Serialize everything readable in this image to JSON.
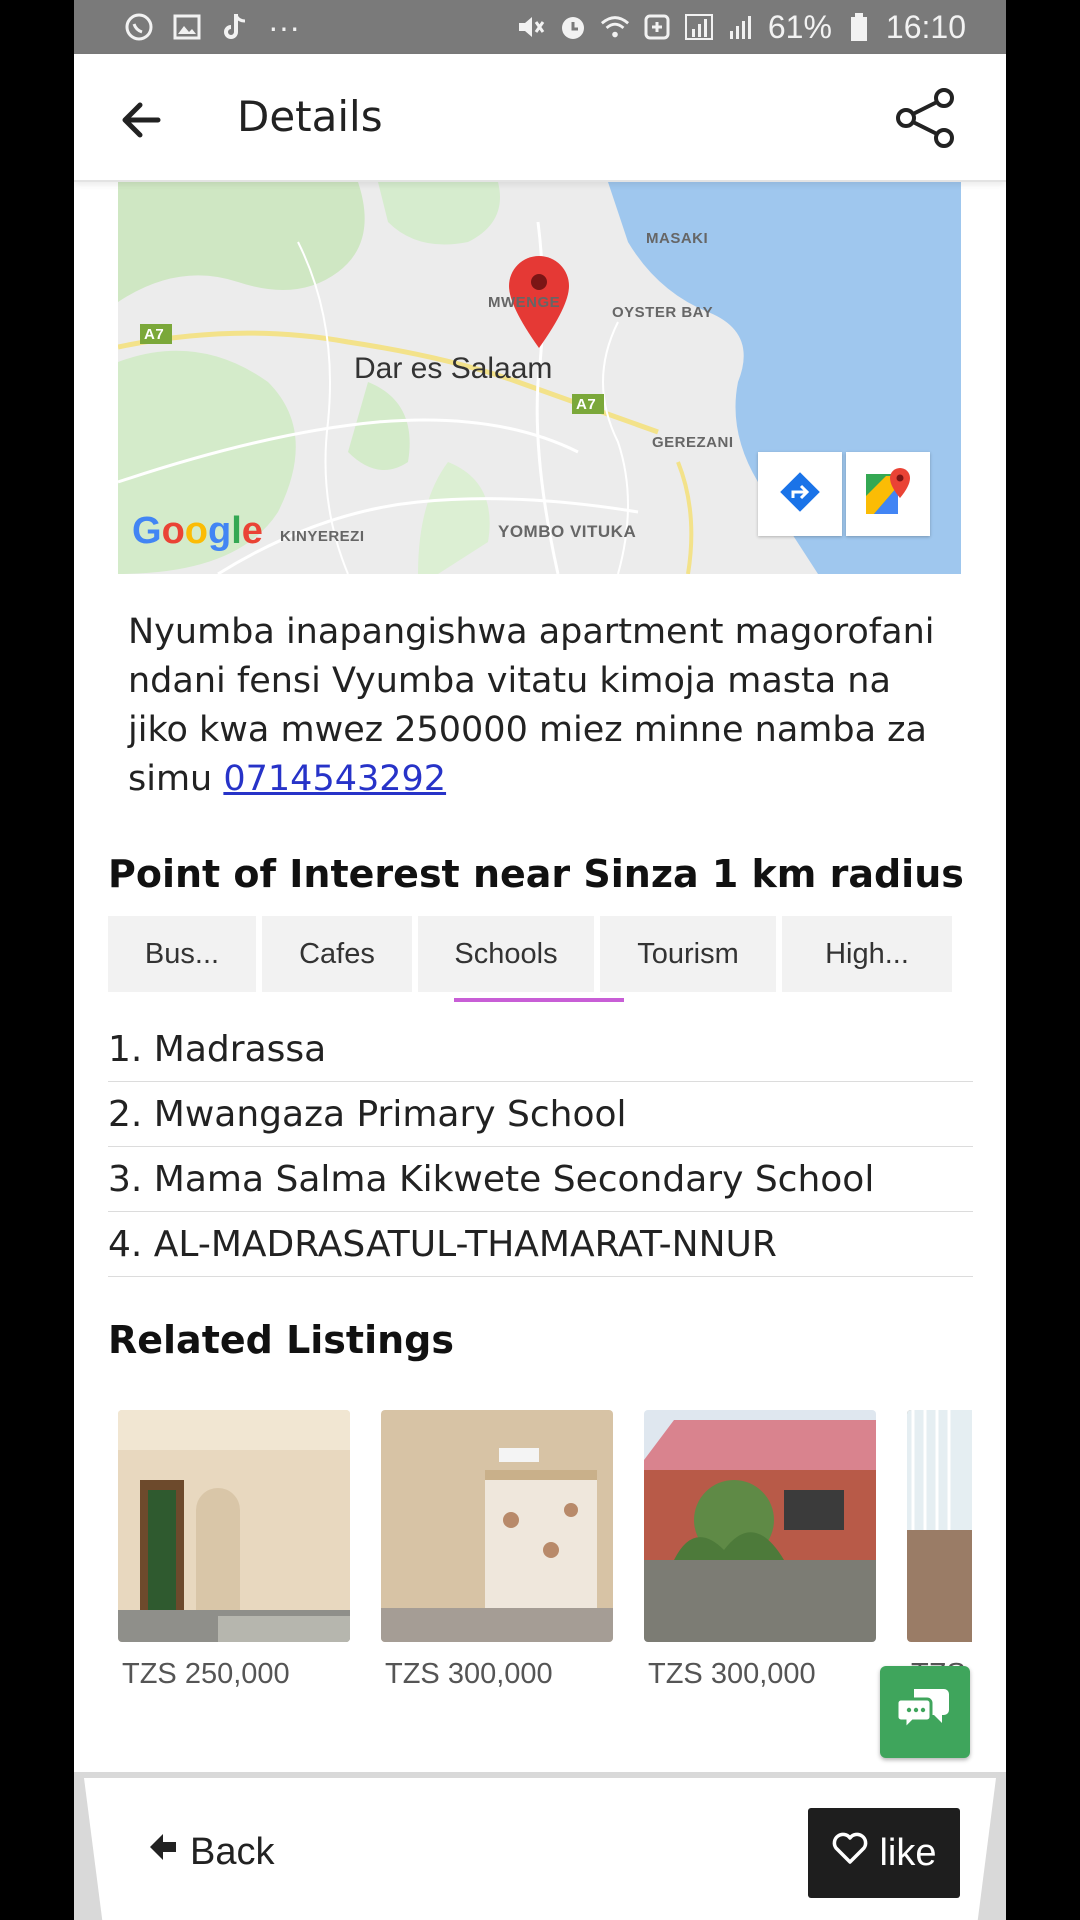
{
  "status_bar": {
    "battery": "61%",
    "time": "16:10",
    "left_icons": [
      "whatsapp-icon",
      "gallery-icon",
      "tiktok-icon",
      "more-dots-icon"
    ],
    "right_icons": [
      "mute-icon",
      "alarm-icon",
      "wifi-icon",
      "data-icon",
      "signal-icon",
      "signal-icon",
      "battery-icon"
    ],
    "more": "···"
  },
  "appbar": {
    "title": "Details"
  },
  "map": {
    "city": "Dar es Salaam",
    "labels": {
      "masaki": "MASAKI",
      "oyster_bay": "OYSTER BAY",
      "gerezani": "GEREZANI",
      "kinyerezi": "KINYEREZI",
      "yombo_vituka": "YOMBO VITUKA",
      "mwenge": "MWENGE",
      "a7_left": "A7",
      "a7_right": "A7"
    },
    "logo": "Google"
  },
  "description": {
    "text": "Nyumba inapangishwa apartment magorofani ndani fensi Vyumba vitatu kimoja masta na jiko kwa mwez 250000 miez minne namba za simu ",
    "phone": "0714543292"
  },
  "poi": {
    "title": "Point of Interest near Sinza 1 km radius",
    "tabs": [
      "Bus...",
      "Cafes",
      "Schools",
      "Tourism",
      "High..."
    ],
    "active_tab": "Schools",
    "items": [
      "1. Madrassa",
      "2. Mwangaza Primary School",
      "3. Mama Salma Kikwete Secondary School",
      "4. AL-MADRASATUL-THAMARAT-NNUR"
    ]
  },
  "related": {
    "title": "Related Listings",
    "listings": [
      {
        "price": "TZS 250,000"
      },
      {
        "price": "TZS 300,000"
      },
      {
        "price": "TZS 300,000"
      },
      {
        "price": "TZS"
      }
    ]
  },
  "bottom": {
    "back_label": "Back",
    "like_label": "like"
  },
  "colors": {
    "accent_tab": "#c85ed6",
    "chat_fab": "#3fa55c",
    "link": "#2733c8"
  }
}
